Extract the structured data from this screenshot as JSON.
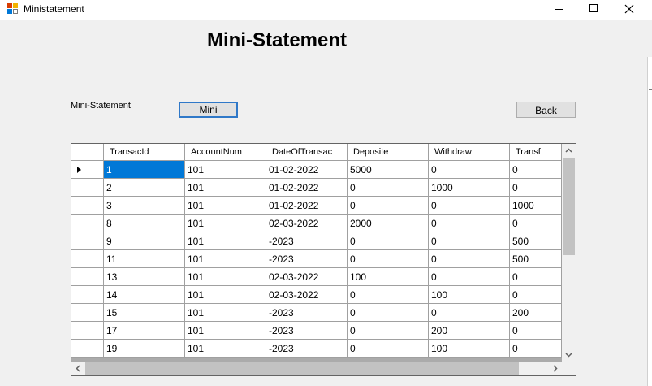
{
  "window": {
    "title": "Ministatement"
  },
  "heading": "Mini-Statement",
  "label": "Mini-Statement",
  "buttons": {
    "mini": "Mini",
    "back": "Back"
  },
  "grid": {
    "columns": [
      "TransacId",
      "AccountNum",
      "DateOfTransac",
      "Deposite",
      "Withdraw",
      "Transf"
    ],
    "rows": [
      [
        "1",
        "101",
        "01-02-2022",
        "5000",
        "0",
        "0"
      ],
      [
        "2",
        "101",
        "01-02-2022",
        "0",
        "1000",
        "0"
      ],
      [
        "3",
        "101",
        "01-02-2022",
        "0",
        "0",
        "1000"
      ],
      [
        "8",
        "101",
        "02-03-2022",
        "2000",
        "0",
        "0"
      ],
      [
        "9",
        "101",
        "-2023",
        "0",
        "0",
        "500"
      ],
      [
        "11",
        "101",
        "-2023",
        "0",
        "0",
        "500"
      ],
      [
        "13",
        "101",
        "02-03-2022",
        "100",
        "0",
        "0"
      ],
      [
        "14",
        "101",
        "02-03-2022",
        "0",
        "100",
        "0"
      ],
      [
        "15",
        "101",
        "-2023",
        "0",
        "0",
        "200"
      ],
      [
        "17",
        "101",
        "-2023",
        "0",
        "200",
        "0"
      ],
      [
        "19",
        "101",
        "-2023",
        "0",
        "100",
        "0"
      ]
    ],
    "selected": {
      "row": 0,
      "col": 0
    },
    "current_row": 0
  },
  "colors": {
    "selection": "#0078d7",
    "focus_border": "#2f78c8"
  }
}
